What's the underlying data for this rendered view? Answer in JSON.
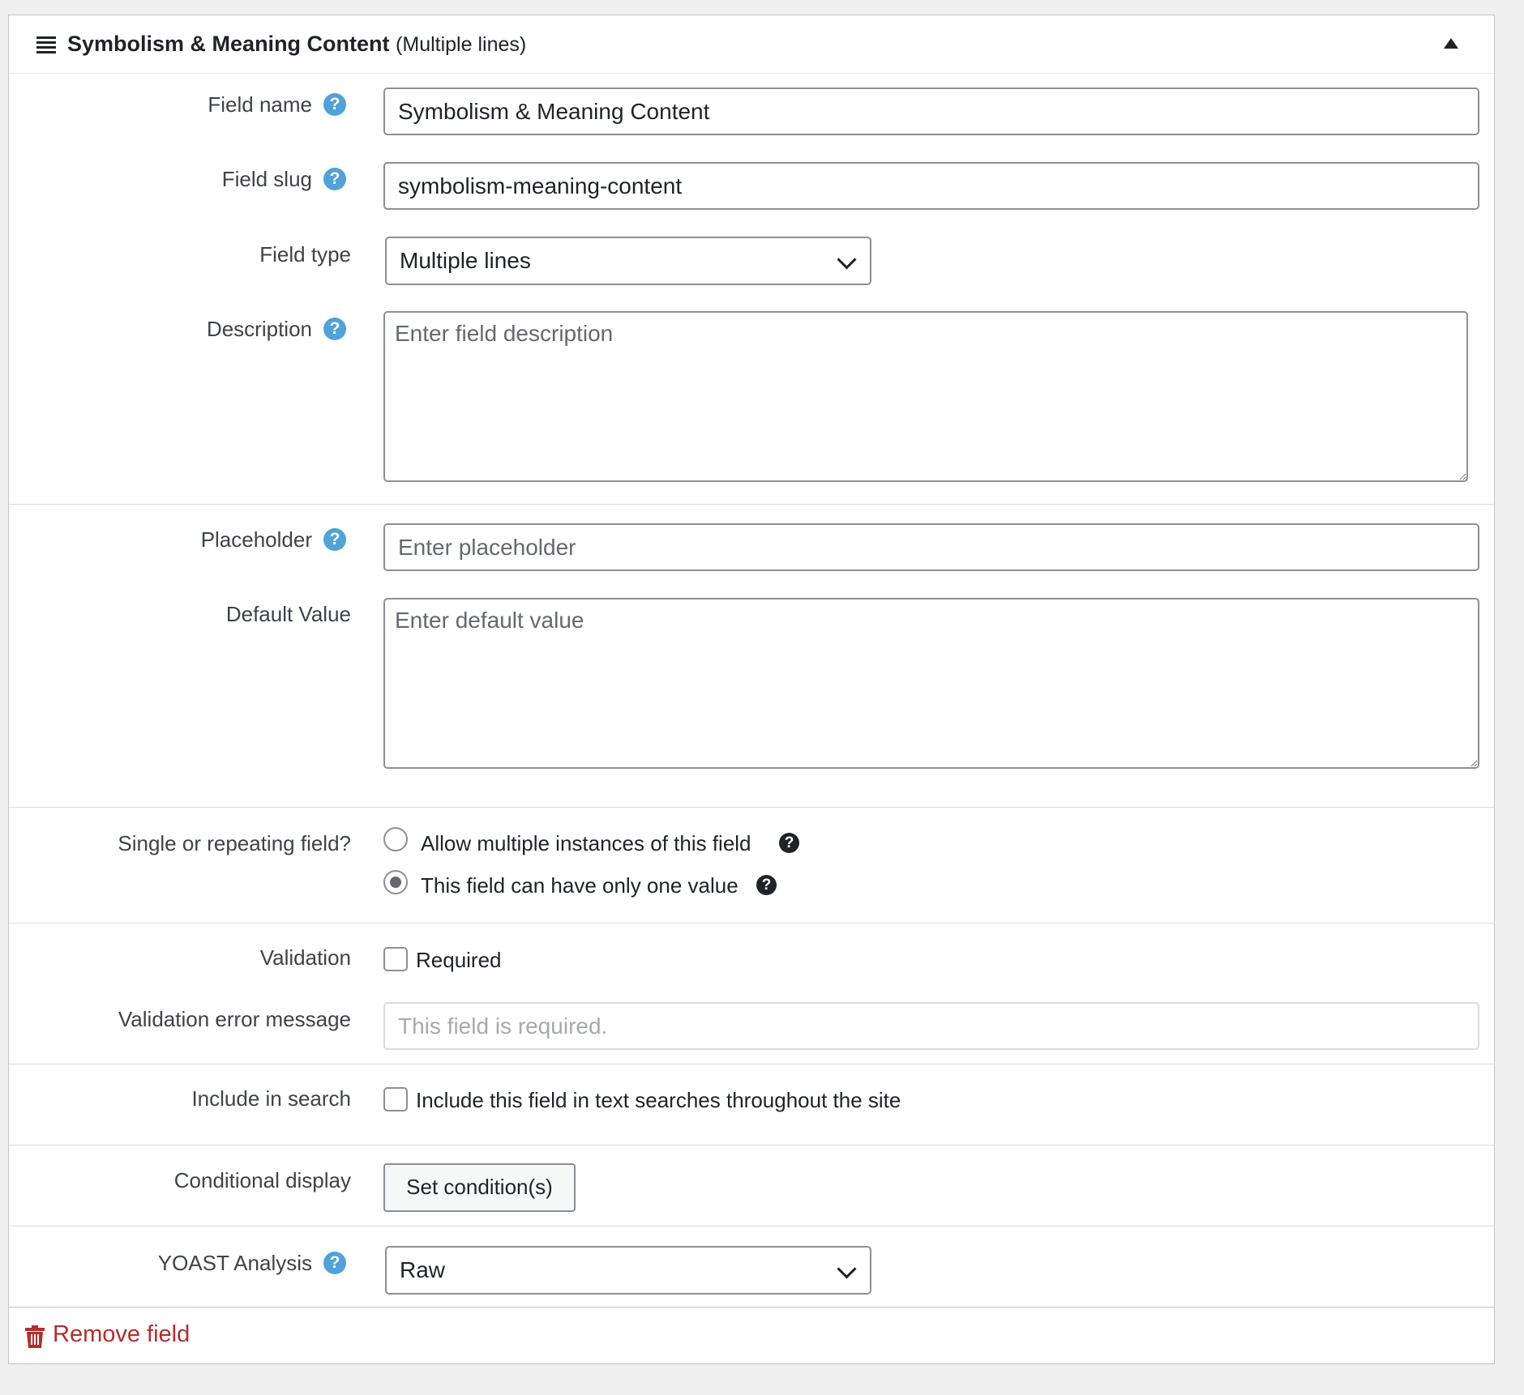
{
  "header": {
    "title": "Symbolism & Meaning Content",
    "type_suffix": "(Multiple lines)"
  },
  "fields": {
    "field_name": {
      "label": "Field name",
      "value": "Symbolism & Meaning Content"
    },
    "field_slug": {
      "label": "Field slug",
      "value": "symbolism-meaning-content"
    },
    "field_type": {
      "label": "Field type",
      "selected": "Multiple lines"
    },
    "description": {
      "label": "Description",
      "placeholder": "Enter field description"
    },
    "placeholder": {
      "label": "Placeholder",
      "placeholder": "Enter placeholder"
    },
    "default_value": {
      "label": "Default Value",
      "placeholder": "Enter default value"
    },
    "repeat": {
      "label": "Single or repeating field?",
      "option_multiple": "Allow multiple instances of this field",
      "option_single": "This field can have only one value",
      "selected": "single"
    },
    "validation": {
      "label": "Validation",
      "required_label": "Required",
      "required_checked": false
    },
    "validation_error": {
      "label": "Validation error message",
      "placeholder": "This field is required."
    },
    "include_search": {
      "label": "Include in search",
      "option": "Include this field in text searches throughout the site",
      "checked": false
    },
    "conditional": {
      "label": "Conditional display",
      "button": "Set condition(s)"
    },
    "yoast": {
      "label": "YOAST Analysis",
      "selected": "Raw"
    }
  },
  "footer": {
    "remove_label": "Remove field"
  },
  "icons": {
    "help": "question-circle-icon",
    "drag": "drag-handle-icon",
    "collapse": "collapse-arrow-icon",
    "trash": "trash-icon"
  },
  "colors": {
    "help_blue": "#4fa3d8",
    "danger": "#b32d2e"
  }
}
